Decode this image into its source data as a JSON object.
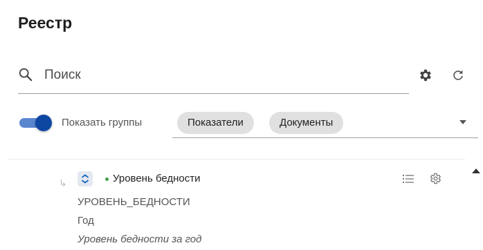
{
  "page": {
    "title": "Реестр"
  },
  "search": {
    "placeholder": "Поиск",
    "value": ""
  },
  "filters": {
    "toggle_label": "Показать группы",
    "toggle_on": true,
    "chips": [
      "Показатели",
      "Документы"
    ]
  },
  "items": [
    {
      "title": "Уровень бедности",
      "code": "УРОВЕНЬ_БЕДНОСТИ",
      "period": "Год",
      "description": "Уровень бедности за год",
      "status_color": "#43a047"
    }
  ],
  "colors": {
    "accent": "#0d47a1",
    "toggle_track": "#5a86d0",
    "chip_bg": "#e0e0e0"
  }
}
